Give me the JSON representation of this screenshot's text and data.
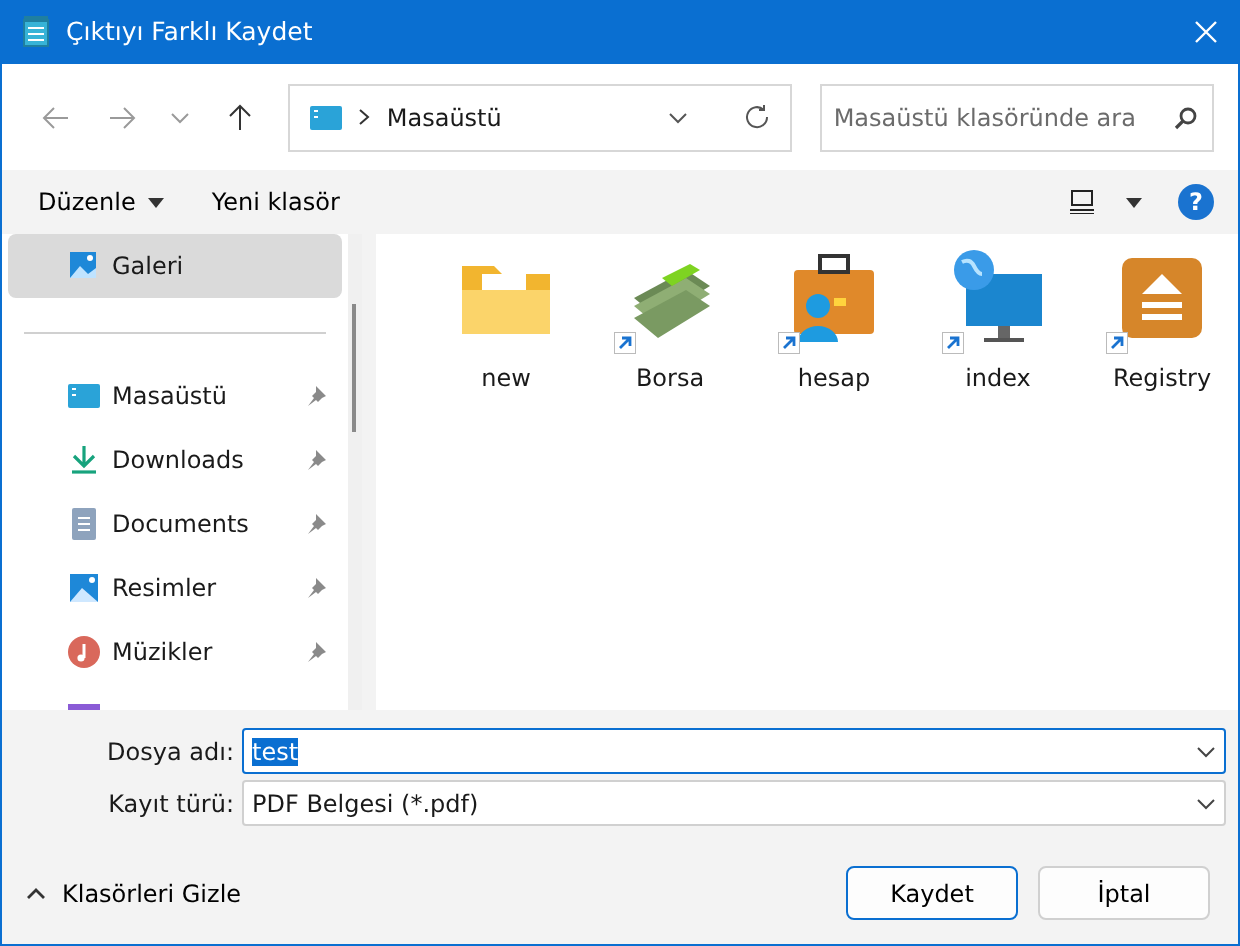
{
  "window": {
    "title": "Çıktıyı Farklı Kaydet"
  },
  "navigation": {
    "breadcrumb": "Masaüstü",
    "search": {
      "placeholder": "Masaüstü klasöründe ara"
    }
  },
  "toolbar": {
    "organize": "Düzenle",
    "new_folder": "Yeni klasör",
    "help": "?"
  },
  "sidebar": {
    "groups": [
      {
        "items": [
          {
            "label": "Galeri",
            "kind": "gallery",
            "selected": true,
            "pinned": false
          }
        ]
      },
      {
        "items": [
          {
            "label": "Masaüstü",
            "kind": "desktop",
            "selected": false,
            "pinned": true
          },
          {
            "label": "Downloads",
            "kind": "download",
            "selected": false,
            "pinned": true
          },
          {
            "label": "Documents",
            "kind": "document",
            "selected": false,
            "pinned": true
          },
          {
            "label": "Resimler",
            "kind": "pictures",
            "selected": false,
            "pinned": true
          },
          {
            "label": "Müzikler",
            "kind": "music",
            "selected": false,
            "pinned": true
          }
        ]
      }
    ]
  },
  "files": [
    {
      "name": "new",
      "kind": "folder",
      "shortcut": false
    },
    {
      "name": "Borsa",
      "kind": "money",
      "shortcut": true
    },
    {
      "name": "hesap",
      "kind": "briefcase",
      "shortcut": true
    },
    {
      "name": "index",
      "kind": "monitor",
      "shortcut": true
    },
    {
      "name": "Registry",
      "kind": "eject",
      "shortcut": true
    }
  ],
  "form": {
    "file_name_label": "Dosya adı:",
    "file_name": "test",
    "file_type_label": "Kayıt türü:",
    "file_type": "PDF Belgesi (*.pdf)"
  },
  "footer": {
    "hide_folders": "Klasörleri Gizle",
    "save": "Kaydet",
    "cancel": "İptal"
  }
}
